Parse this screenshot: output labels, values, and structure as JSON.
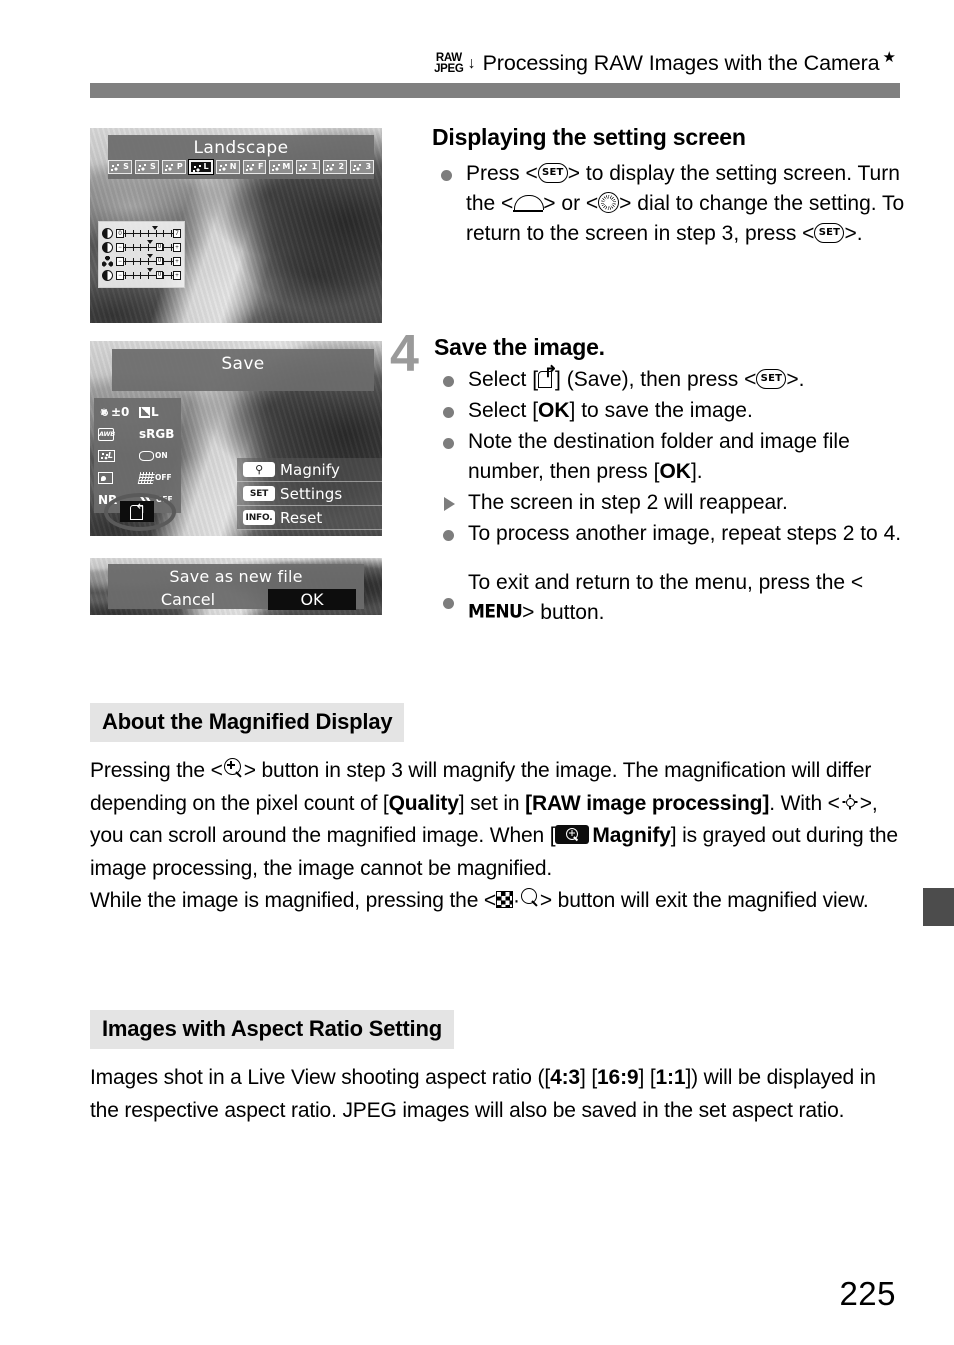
{
  "header": {
    "raw_label": "RAW",
    "jpeg_label": "JPEG",
    "arrow": "↓",
    "title": "Processing RAW Images with the Camera",
    "star": "★"
  },
  "screens": {
    "picture_style": {
      "title": "Landscape",
      "styles": [
        {
          "label": "S",
          "selected": false,
          "auto": true
        },
        {
          "label": "S",
          "selected": false
        },
        {
          "label": "P",
          "selected": false
        },
        {
          "label": "L",
          "selected": true
        },
        {
          "label": "N",
          "selected": false
        },
        {
          "label": "F",
          "selected": false
        },
        {
          "label": "M",
          "selected": false
        },
        {
          "label": "1",
          "selected": false
        },
        {
          "label": "2",
          "selected": false
        },
        {
          "label": "3",
          "selected": false
        }
      ],
      "params": [
        {
          "icon": "sharpness-icon",
          "left_cap": "0",
          "right_cap": "7",
          "pointer_pct": 56
        },
        {
          "icon": "contrast-icon",
          "left_cap": "−",
          "right_cap": "+",
          "pointer_pct": 50,
          "zero": "0"
        },
        {
          "icon": "saturation-icon",
          "left_cap": "−",
          "right_cap": "+",
          "pointer_pct": 50,
          "zero": "0"
        },
        {
          "icon": "color-tone-icon",
          "left_cap": "−",
          "right_cap": "+",
          "pointer_pct": 50,
          "zero": "0"
        }
      ]
    },
    "save_screen": {
      "title": "Save",
      "settings": [
        {
          "icon": "brightness-icon",
          "value": "±0"
        },
        {
          "icon": "quality-icon",
          "value": "L"
        },
        {
          "icon": "white-balance-icon",
          "value": "AWB"
        },
        {
          "icon": "color-space-icon",
          "value": "sRGB"
        },
        {
          "icon": "picture-style-icon",
          "value": "L"
        },
        {
          "icon": "peripheral-illum-icon",
          "value": "ON"
        },
        {
          "icon": "auto-lighting-optimizer-icon",
          "value": ""
        },
        {
          "icon": "distortion-correction-icon",
          "value": "OFF"
        },
        {
          "icon": "noise-reduction-icon",
          "value": "NR"
        },
        {
          "icon": "chromatic-aberration-icon",
          "value": "OFF"
        }
      ],
      "save_button_icon": "save-icon",
      "buttons": [
        {
          "badge": "magnify-icon",
          "label": "Magnify"
        },
        {
          "badge": "SET",
          "label": "Settings"
        },
        {
          "badge": "INFO.",
          "label": "Reset"
        }
      ]
    },
    "save_dialog": {
      "title": "Save as new file",
      "cancel": "Cancel",
      "ok": "OK"
    }
  },
  "section_display": {
    "heading": "Displaying the setting screen",
    "bullet": {
      "p1": "Press <",
      "p2": "> to display the setting screen. Turn the <",
      "p3": "> or <",
      "p4": "> dial to change the setting. To return to the screen in step 3, press <",
      "p5": ">."
    }
  },
  "step4": {
    "number": "4",
    "heading": "Save the image.",
    "bullets": {
      "b1_a": "Select [",
      "b1_b": "] (Save), then press <",
      "b1_c": ">.",
      "b2_a": "Select [",
      "b2_b": "OK",
      "b2_c": "] to save the image.",
      "b3_a": "Note the destination folder and image file number, then press [",
      "b3_b": "OK",
      "b3_c": "].",
      "b4": "The screen in step 2 will reappear.",
      "b5": "To process another image, repeat steps 2 to 4.",
      "b6_a": "To exit and return to the menu, press the <",
      "b6_b": "MENU",
      "b6_c": "> button."
    }
  },
  "magnified_section": {
    "heading": "About the Magnified Display",
    "t1": "Pressing the <",
    "t2": "> button in step 3 will magnify the image. The magnification will differ depending on the pixel count of [",
    "t3": "Quality",
    "t4": "] set in ",
    "t5": "[RAW image processing]",
    "t6": ". With <",
    "t7": ">, you can scroll around the magnified image. When [",
    "t8": "Magnify",
    "t9": "] is grayed out during the image processing, the image cannot be magnified.",
    "t10": "While the image is magnified, pressing the <",
    "t11": "·",
    "t12": "> button will exit the magnified view."
  },
  "aspect_section": {
    "heading": "Images with Aspect Ratio Setting",
    "t1": "Images shot in a Live View shooting aspect ratio ([",
    "r1": "4:3",
    "t2": "] [",
    "r2": "16:9",
    "t3": "] [",
    "r3": "1:1",
    "t4": "]) will be displayed in the respective aspect ratio. JPEG images will also be saved in the set aspect ratio."
  },
  "footer": {
    "page_number": "225"
  }
}
